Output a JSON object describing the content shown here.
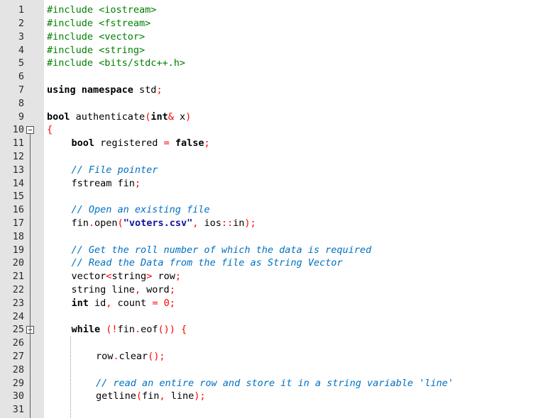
{
  "colors": {
    "gutter_bg": "#e4e4e4",
    "preprocessor": "#008000",
    "keyword": "#000000",
    "operator": "#ff0000",
    "comment": "#0070c0",
    "string": "#1010a0"
  },
  "fold_markers": [
    10,
    25
  ],
  "lines": [
    {
      "n": "1",
      "indent": 0,
      "tokens": [
        {
          "t": "#include <iostream>",
          "c": "pp"
        }
      ]
    },
    {
      "n": "2",
      "indent": 0,
      "tokens": [
        {
          "t": "#include <fstream>",
          "c": "pp"
        }
      ]
    },
    {
      "n": "3",
      "indent": 0,
      "tokens": [
        {
          "t": "#include <vector>",
          "c": "pp"
        }
      ]
    },
    {
      "n": "4",
      "indent": 0,
      "tokens": [
        {
          "t": "#include <string>",
          "c": "pp"
        }
      ]
    },
    {
      "n": "5",
      "indent": 0,
      "tokens": [
        {
          "t": "#include <bits/stdc++.h>",
          "c": "pp"
        }
      ]
    },
    {
      "n": "6",
      "indent": 0,
      "tokens": []
    },
    {
      "n": "7",
      "indent": 0,
      "tokens": [
        {
          "t": "using namespace",
          "c": "kw"
        },
        {
          "t": " std",
          "c": "plain"
        },
        {
          "t": ";",
          "c": "op"
        }
      ]
    },
    {
      "n": "8",
      "indent": 0,
      "tokens": []
    },
    {
      "n": "9",
      "indent": 0,
      "tokens": [
        {
          "t": "bool",
          "c": "kw"
        },
        {
          "t": " authenticate",
          "c": "plain"
        },
        {
          "t": "(",
          "c": "op"
        },
        {
          "t": "int",
          "c": "kw"
        },
        {
          "t": "&",
          "c": "op"
        },
        {
          "t": " x",
          "c": "plain"
        },
        {
          "t": ")",
          "c": "op"
        }
      ]
    },
    {
      "n": "10",
      "indent": 0,
      "tokens": [
        {
          "t": "{",
          "c": "op"
        }
      ]
    },
    {
      "n": "11",
      "indent": 1,
      "tokens": [
        {
          "t": "bool",
          "c": "kw"
        },
        {
          "t": " registered ",
          "c": "plain"
        },
        {
          "t": "=",
          "c": "op"
        },
        {
          "t": " ",
          "c": "plain"
        },
        {
          "t": "false",
          "c": "kw"
        },
        {
          "t": ";",
          "c": "op"
        }
      ]
    },
    {
      "n": "12",
      "indent": 0,
      "tokens": []
    },
    {
      "n": "13",
      "indent": 1,
      "tokens": [
        {
          "t": "// File pointer",
          "c": "cm"
        }
      ]
    },
    {
      "n": "14",
      "indent": 1,
      "tokens": [
        {
          "t": "fstream fin",
          "c": "plain"
        },
        {
          "t": ";",
          "c": "op"
        }
      ]
    },
    {
      "n": "15",
      "indent": 0,
      "tokens": []
    },
    {
      "n": "16",
      "indent": 1,
      "tokens": [
        {
          "t": "// Open an existing file",
          "c": "cm"
        }
      ]
    },
    {
      "n": "17",
      "indent": 1,
      "tokens": [
        {
          "t": "fin",
          "c": "plain"
        },
        {
          "t": ".",
          "c": "op"
        },
        {
          "t": "open",
          "c": "plain"
        },
        {
          "t": "(",
          "c": "op"
        },
        {
          "t": "\"voters.csv\"",
          "c": "str"
        },
        {
          "t": ",",
          "c": "op"
        },
        {
          "t": " ios",
          "c": "plain"
        },
        {
          "t": "::",
          "c": "op"
        },
        {
          "t": "in",
          "c": "plain"
        },
        {
          "t": ");",
          "c": "op"
        }
      ]
    },
    {
      "n": "18",
      "indent": 0,
      "tokens": []
    },
    {
      "n": "19",
      "indent": 1,
      "tokens": [
        {
          "t": "// Get the roll number of which the data is required",
          "c": "cm"
        }
      ]
    },
    {
      "n": "20",
      "indent": 1,
      "tokens": [
        {
          "t": "// Read the Data from the file as String Vector",
          "c": "cm"
        }
      ]
    },
    {
      "n": "21",
      "indent": 1,
      "tokens": [
        {
          "t": "vector",
          "c": "plain"
        },
        {
          "t": "<",
          "c": "op"
        },
        {
          "t": "string",
          "c": "plain"
        },
        {
          "t": ">",
          "c": "op"
        },
        {
          "t": " row",
          "c": "plain"
        },
        {
          "t": ";",
          "c": "op"
        }
      ]
    },
    {
      "n": "22",
      "indent": 1,
      "tokens": [
        {
          "t": "string line",
          "c": "plain"
        },
        {
          "t": ",",
          "c": "op"
        },
        {
          "t": " word",
          "c": "plain"
        },
        {
          "t": ";",
          "c": "op"
        }
      ]
    },
    {
      "n": "23",
      "indent": 1,
      "tokens": [
        {
          "t": "int",
          "c": "kw"
        },
        {
          "t": " id",
          "c": "plain"
        },
        {
          "t": ",",
          "c": "op"
        },
        {
          "t": " count ",
          "c": "plain"
        },
        {
          "t": "=",
          "c": "op"
        },
        {
          "t": " 0",
          "c": "op"
        },
        {
          "t": ";",
          "c": "op"
        }
      ]
    },
    {
      "n": "24",
      "indent": 0,
      "tokens": []
    },
    {
      "n": "25",
      "indent": 1,
      "tokens": [
        {
          "t": "while",
          "c": "kw"
        },
        {
          "t": " ",
          "c": "plain"
        },
        {
          "t": "(!",
          "c": "op"
        },
        {
          "t": "fin",
          "c": "plain"
        },
        {
          "t": ".",
          "c": "op"
        },
        {
          "t": "eof",
          "c": "plain"
        },
        {
          "t": "())",
          "c": "op"
        },
        {
          "t": " ",
          "c": "plain"
        },
        {
          "t": "{",
          "c": "op"
        }
      ]
    },
    {
      "n": "26",
      "indent": 0,
      "tokens": []
    },
    {
      "n": "27",
      "indent": 2,
      "tokens": [
        {
          "t": "row",
          "c": "plain"
        },
        {
          "t": ".",
          "c": "op"
        },
        {
          "t": "clear",
          "c": "plain"
        },
        {
          "t": "();",
          "c": "op"
        }
      ]
    },
    {
      "n": "28",
      "indent": 0,
      "tokens": []
    },
    {
      "n": "29",
      "indent": 2,
      "tokens": [
        {
          "t": "// read an entire row and store it in a string variable 'line'",
          "c": "cm"
        }
      ]
    },
    {
      "n": "30",
      "indent": 2,
      "tokens": [
        {
          "t": "getline",
          "c": "plain"
        },
        {
          "t": "(",
          "c": "op"
        },
        {
          "t": "fin",
          "c": "plain"
        },
        {
          "t": ",",
          "c": "op"
        },
        {
          "t": " line",
          "c": "plain"
        },
        {
          "t": ");",
          "c": "op"
        }
      ]
    },
    {
      "n": "31",
      "indent": 0,
      "tokens": []
    }
  ]
}
